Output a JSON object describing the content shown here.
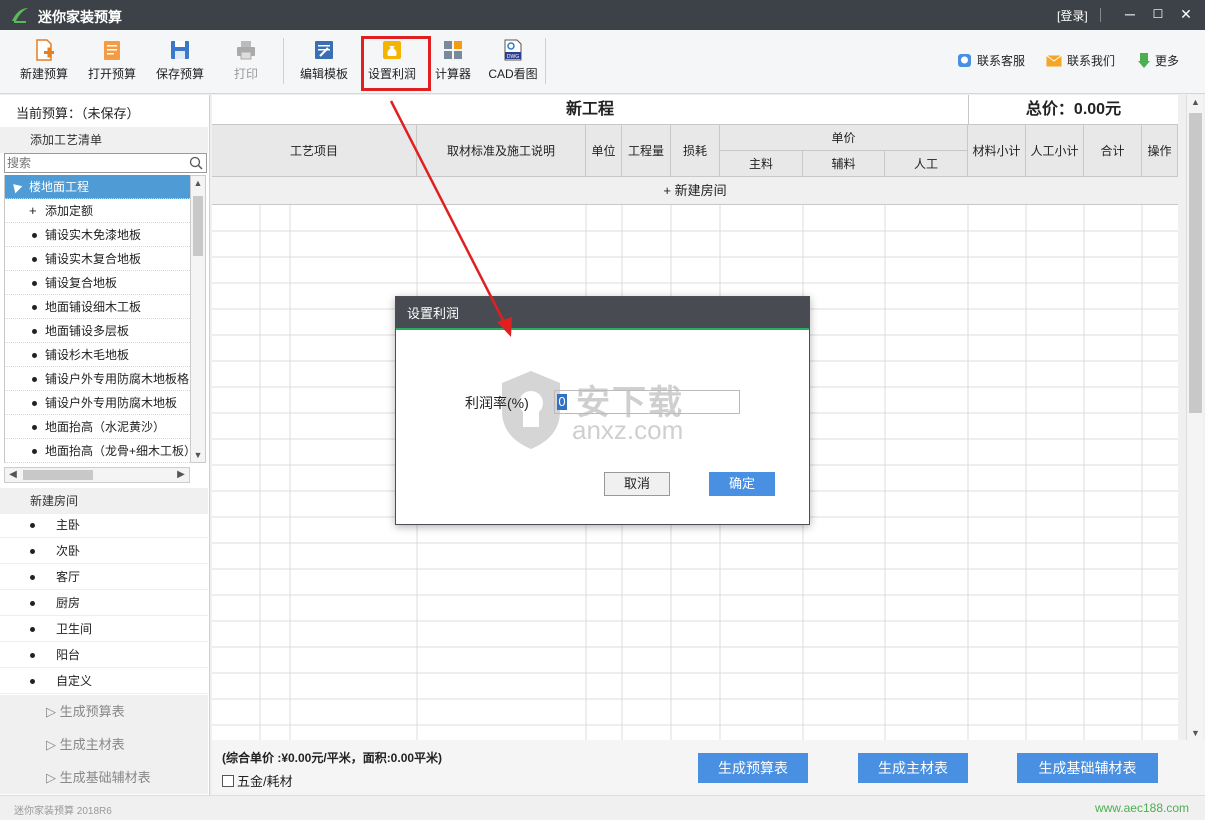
{
  "window": {
    "title": "迷你家装预算",
    "login": "[登录]",
    "controls": [
      "─",
      "☐",
      "✕"
    ]
  },
  "toolbar": {
    "new_budget": "新建预算",
    "open_budget": "打开预算",
    "save_budget": "保存预算",
    "print": "打印",
    "edit_template": "编辑模板",
    "set_profit": "设置利润",
    "calculator": "计算器",
    "cad_view": "CAD看图",
    "cad_badge": "DWG",
    "contact_service": "联系客服",
    "contact_us": "联系我们",
    "more": "更多"
  },
  "left_panel": {
    "current_budget_label": "当前预算：",
    "current_budget_value": "（未保存）",
    "add_craft_list": "添加工艺清单",
    "search_placeholder": "搜索",
    "tree": {
      "selected": "楼地面工程",
      "add_quota": "添加定额",
      "items": [
        "铺设实木免漆地板",
        "铺设实木复合地板",
        "铺设复合地板",
        "地面铺设细木工板",
        "地面铺设多层板",
        "铺设杉木毛地板",
        "铺设户外专用防腐木地板格",
        "铺设户外专用防腐木地板",
        "地面抬高（水泥黄沙）",
        "地面抬高（龙骨+细木工板）"
      ]
    },
    "new_room": "新建房间",
    "rooms": [
      "主卧",
      "次卧",
      "客厅",
      "厨房",
      "卫生间",
      "阳台",
      "自定义"
    ],
    "gen_links": [
      "生成预算表",
      "生成主材表",
      "生成基础辅材表"
    ]
  },
  "main": {
    "project_title": "新工程",
    "total_label": "总价：",
    "total_value": "0.00元",
    "headers": {
      "craft": "工艺项目",
      "standard": "取材标准及施工说明",
      "unit": "单位",
      "quantity": "工程量",
      "loss": "损耗",
      "unit_price": "单价",
      "main_material": "主料",
      "aux_material": "辅料",
      "labor": "人工",
      "material_subtotal": "材料小计",
      "labor_subtotal": "人工小计",
      "total": "合计",
      "operation": "操作"
    },
    "new_room_row": "+ 新建房间"
  },
  "bottom": {
    "summary": "(综合单价 :¥0.00元/平米，面积:0.00平米)",
    "hardware_checkbox": "五金/耗材",
    "btn_budget": "生成预算表",
    "btn_main": "生成主材表",
    "btn_aux": "生成基础辅材表"
  },
  "status": {
    "version": "迷你家装预算 2018R6",
    "url": "www.aec188.com"
  },
  "dialog": {
    "title": "设置利润",
    "field_label": "利润率(%)",
    "field_value": "0",
    "cancel": "取消",
    "ok": "确定"
  },
  "watermark": {
    "text": "安下载",
    "url": "anxz.com"
  },
  "colors": {
    "titlebar": "#3d4248",
    "accent_blue": "#4a90e2",
    "tree_selected": "#4e9bd6",
    "highlight_red": "#e02020",
    "status_green": "#4caf50"
  }
}
